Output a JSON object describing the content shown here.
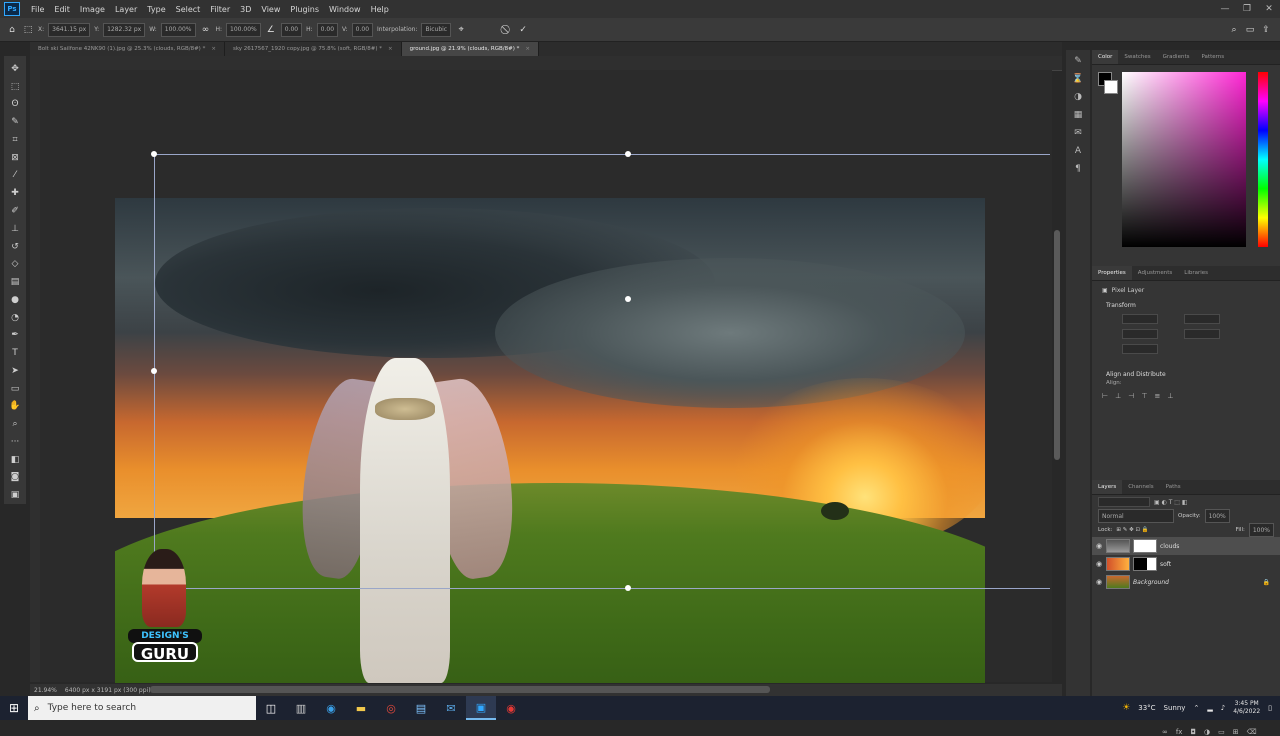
{
  "app": {
    "logo_text": "Ps"
  },
  "menu": [
    "File",
    "Edit",
    "Image",
    "Layer",
    "Type",
    "Select",
    "Filter",
    "3D",
    "View",
    "Plugins",
    "Window",
    "Help"
  ],
  "window_controls": [
    "—",
    "❐",
    "✕"
  ],
  "options_bar": {
    "x_label": "X:",
    "x_value": "3641.15 px",
    "y_label": "Y:",
    "y_value": "1282.32 px",
    "w_label": "W:",
    "w_value": "100.00%",
    "h_label": "H:",
    "h_value": "100.00%",
    "angle_value": "0.00",
    "hskew_label": "H:",
    "hskew_value": "0.00",
    "vskew_label": "V:",
    "vskew_value": "0.00",
    "interp_label": "Interpolation:",
    "interp_value": "Bicubic",
    "cancel_icon": "⃠",
    "commit_icon": "✓"
  },
  "tabs": [
    {
      "label": "Bolt ski Sailfone 42NK90 (1).jpg @ 25.3% (clouds, RGB/8#) *",
      "active": false
    },
    {
      "label": "sky 2617567_1920 copy.jpg @ 75.8% (soft, RGB/8#) *",
      "active": false
    },
    {
      "label": "ground.jpg @ 21.9% (clouds, RGB/8#) *",
      "active": true
    }
  ],
  "status": {
    "zoom": "21.94%",
    "doc_info": "6400 px x 3191 px (300 ppi)"
  },
  "logo": {
    "line1": "DESIGN'S",
    "line2": "GURU"
  },
  "color_panel": {
    "tabs": [
      "Color",
      "Swatches",
      "Gradients",
      "Patterns"
    ]
  },
  "properties_panel": {
    "tabs": [
      "Properties",
      "Adjustments",
      "Libraries"
    ],
    "layer_type": "Pixel Layer",
    "transform_label": "Transform",
    "align_label": "Align and Distribute",
    "align_sub": "Align:"
  },
  "layers_panel": {
    "tabs": [
      "Layers",
      "Channels",
      "Paths"
    ],
    "blend_mode": "Normal",
    "opacity_label": "Opacity:",
    "opacity_value": "100%",
    "lock_label": "Lock:",
    "fill_label": "Fill:",
    "fill_value": "100%",
    "layers": [
      {
        "name": "clouds",
        "selected": true
      },
      {
        "name": "soft",
        "selected": false
      },
      {
        "name": "Background",
        "selected": false
      }
    ]
  },
  "taskbar": {
    "search_placeholder": "Type here to search",
    "weather_temp": "33°C",
    "weather_text": "Sunny",
    "time": "3:45 PM",
    "date": "4/6/2022"
  },
  "colors": {
    "accent": "#31a8ff",
    "selection": "#9aa6c8"
  }
}
